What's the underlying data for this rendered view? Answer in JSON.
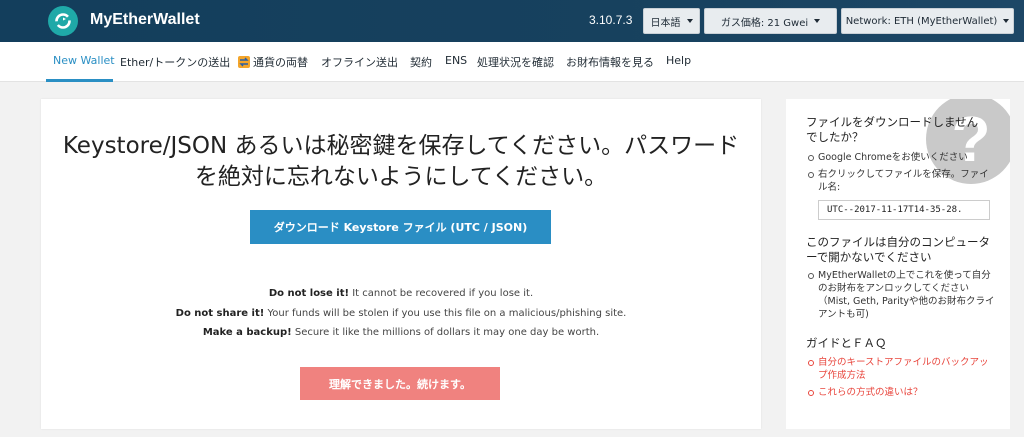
{
  "header": {
    "brand": "MyEtherWallet",
    "version": "3.10.7.3",
    "language_label": "日本語",
    "gas_label": "ガス価格: 21 Gwei",
    "network_label": "Network: ETH (MyEtherWallet)"
  },
  "nav": {
    "items": [
      {
        "label": "New Wallet",
        "active": true
      },
      {
        "label": "Ether/トークンの送出"
      },
      {
        "label": "通貨の両替",
        "icon": "swap-icon"
      },
      {
        "label": "オフライン送出"
      },
      {
        "label": "契約"
      },
      {
        "label": "ENS"
      },
      {
        "label": "処理状況を確認"
      },
      {
        "label": "お財布情報を見る"
      },
      {
        "label": "Help"
      }
    ]
  },
  "main": {
    "title": "Keystore/JSON あるいは秘密鍵を保存してください。パスワードを絶対に忘れないようにしてください。",
    "download_button": "ダウンロード Keystore ファイル (UTC / JSON)",
    "warnings": [
      {
        "bold": "Do not lose it!",
        "text": " It cannot be recovered if you lose it."
      },
      {
        "bold": "Do not share it!",
        "text": " Your funds will be stolen if you use this file on a malicious/phishing site."
      },
      {
        "bold": "Make a backup!",
        "text": " Secure it like the millions of dollars it may one day be worth."
      }
    ],
    "continue_button": "理解できました。続けます。"
  },
  "sidebar": {
    "help_icon": "question-mark-icon",
    "section1_title": "ファイルをダウンロードしませんでしたか？",
    "section1_items": [
      "Google Chromeをお使いください",
      "右クリックしてファイルを保存。ファイル名:"
    ],
    "filename": "UTC--2017-11-17T14-35-28.",
    "section2_title": "このファイルは自分のコンピューターで開かないでください",
    "section2_items": [
      "MyEtherWalletの上でこれを使って自分のお財布をアンロックしてください（Mist, Geth, Parityや他のお財布クライアントも可)"
    ],
    "section3_title": "ガイドとＦＡＱ",
    "section3_links": [
      "自分のキーストアファイルのバックアップ作成方法",
      "これらの方式の違いは？"
    ]
  },
  "colors": {
    "header_bg": "#133e5c",
    "accent_blue": "#2a8ec4",
    "continue_btn": "#f0827f",
    "link_red": "#e8453c"
  }
}
